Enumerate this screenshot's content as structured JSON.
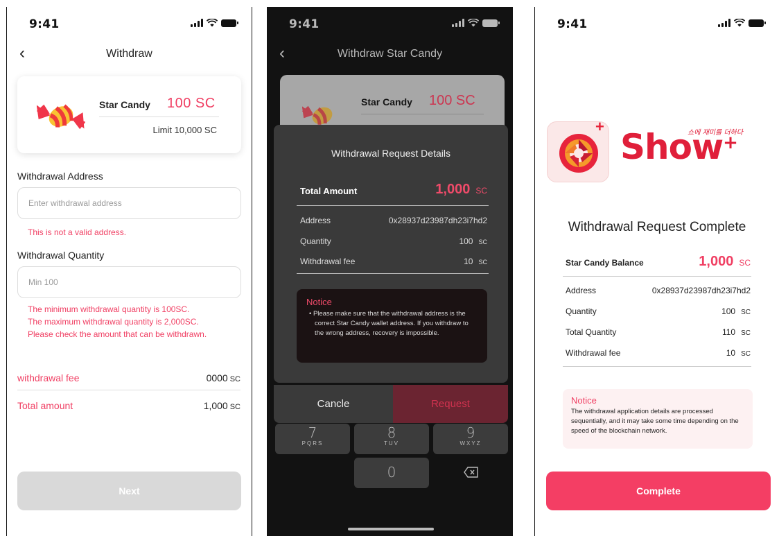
{
  "status": {
    "time": "9:41"
  },
  "screen1": {
    "title": "Withdraw",
    "card": {
      "name": "Star Candy",
      "amount": "100 SC",
      "limit": "Limit  10,000 SC"
    },
    "address_label": "Withdrawal Address",
    "address_placeholder": "Enter withdrawal address",
    "address_error": "This is not a valid address.",
    "quantity_label": "Withdrawal Quantity",
    "quantity_placeholder": "Min 100",
    "quantity_errors": [
      "The minimum withdrawal quantity is 100SC.",
      "The maximum withdrawal quantity is 2,000SC.",
      "Please check the amount that can be withdrawn."
    ],
    "fee_label": "withdrawal fee",
    "fee_value": "0000",
    "total_label": "Total amount",
    "total_value": "1,000",
    "unit": "SC",
    "next_label": "Next"
  },
  "screen2": {
    "title": "Withdraw Star Candy",
    "card": {
      "name": "Star Candy",
      "amount": "100 SC"
    },
    "modal": {
      "title": "Withdrawal Request Details",
      "total_label": "Total Amount",
      "total_value": "1,000",
      "unit": "SC",
      "address_label": "Address",
      "address_value": "0x28937d23987dh23i7hd2",
      "quantity_label": "Quantity",
      "quantity_value": "100",
      "fee_label": "Withdrawal fee",
      "fee_value": "10",
      "notice_title": "Notice",
      "notice_body": "Please make sure that the withdrawal address is the correct Star Candy wallet address. If you withdraw to the wrong address, recovery is impossible.",
      "cancel_label": "Cancle",
      "request_label": "Request"
    },
    "keypad": [
      {
        "num": "7",
        "letters": "PQRS"
      },
      {
        "num": "8",
        "letters": "TUV"
      },
      {
        "num": "9",
        "letters": "WXYZ"
      },
      {
        "num": "0",
        "letters": ""
      }
    ]
  },
  "screen3": {
    "brand": "Show",
    "brand_plus": "+",
    "brand_tagline": "쇼에 재미를 더하다",
    "title": "Withdrawal Request Complete",
    "balance_label": "Star Candy Balance",
    "balance_value": "1,000",
    "unit": "SC",
    "address_label": "Address",
    "address_value": "0x28937d23987dh23i7hd2",
    "quantity_label": "Quantity",
    "quantity_value": "100",
    "total_qty_label": "Total Quantity",
    "total_qty_value": "110",
    "fee_label": "Withdrawal fee",
    "fee_value": "10",
    "notice_title": "Notice",
    "notice_body": "The withdrawal application details are processed sequentially, and it may take some time depending on the speed of the blockchain network.",
    "complete_label": "Complete"
  },
  "colors": {
    "accent": "#f03f63",
    "dark_bg": "#121212",
    "modal_bg": "#3a3a3a"
  }
}
